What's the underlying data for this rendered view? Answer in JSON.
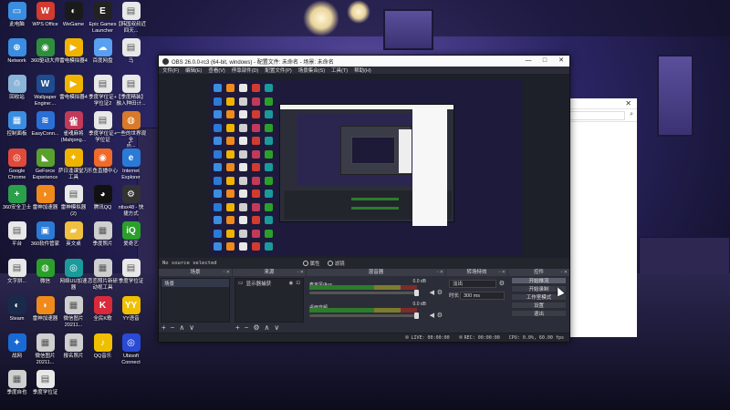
{
  "desktop": {
    "icons": [
      {
        "label": "此电脑",
        "icon": "computer-icon",
        "color": "#3a8de0",
        "glyph": "▭"
      },
      {
        "label": "WPS Office",
        "icon": "wps-icon",
        "color": "#d23b2f",
        "glyph": "W"
      },
      {
        "label": "WeGame",
        "icon": "wegame-icon",
        "color": "#1a1a1a",
        "glyph": "◐"
      },
      {
        "label": "Epic Games\nLauncher",
        "icon": "epic-games-icon",
        "color": "#222222",
        "glyph": "E"
      },
      {
        "label": "【韩国叔叔近\n四天...",
        "icon": "document-icon",
        "color": "#e8e8e8",
        "glyph": "▤"
      },
      {
        "label": "Network",
        "icon": "network-icon",
        "color": "#3a8de0",
        "glyph": "⊕"
      },
      {
        "label": "360驱动大师",
        "icon": "driver-master-icon",
        "color": "#2d8f3c",
        "glyph": "◉"
      },
      {
        "label": "雷电模拟器4",
        "icon": "ldplayer-icon",
        "color": "#f0b400",
        "glyph": "▶"
      },
      {
        "label": "百度网盘",
        "icon": "baidu-netdisk-icon",
        "color": "#5aa0f0",
        "glyph": "☁"
      },
      {
        "label": "马",
        "icon": "document-icon",
        "color": "#e8e8e8",
        "glyph": "▤"
      },
      {
        "label": "回收站",
        "icon": "recycle-bin-icon",
        "color": "#8ab4d8",
        "glyph": "♲"
      },
      {
        "label": "Wallpaper\nEngine:...",
        "icon": "wallpaper-engine-icon",
        "color": "#1f4b8f",
        "glyph": "W"
      },
      {
        "label": "雷电模拟器4",
        "icon": "ldplayer-icon",
        "color": "#f0b400",
        "glyph": "▶"
      },
      {
        "label": "季度学位证+\n学位证2",
        "icon": "document-icon",
        "color": "#e8e8e8",
        "glyph": "▤"
      },
      {
        "label": "【季度精装】\n融入种田计...",
        "icon": "document-icon",
        "color": "#e8e8e8",
        "glyph": "▤"
      },
      {
        "label": "控制面板",
        "icon": "control-panel-icon",
        "color": "#3a8de0",
        "glyph": "▦"
      },
      {
        "label": "EasyConn...",
        "icon": "easyconnect-icon",
        "color": "#2a6fd6",
        "glyph": "≋"
      },
      {
        "label": "雀魂麻将\n(Mahjong...",
        "icon": "mahjong-icon",
        "color": "#c23a5a",
        "glyph": "雀"
      },
      {
        "label": "季度学位证+\n学位证",
        "icon": "document-icon",
        "color": "#e8e8e8",
        "glyph": "▤"
      },
      {
        "label": "一些的世界观全\n点...",
        "icon": "world-icon",
        "color": "#d87a2a",
        "glyph": "◍"
      },
      {
        "label": "Google\nChrome",
        "icon": "chrome-icon",
        "color": "#e04a3a",
        "glyph": "◎"
      },
      {
        "label": "GeForce\nExperience",
        "icon": "geforce-icon",
        "color": "#5aa02c",
        "glyph": "◣"
      },
      {
        "label": "萨日逢课堂万\n工具",
        "icon": "app-icon",
        "color": "#f0b400",
        "glyph": "✦"
      },
      {
        "label": "乐鱼直播中心",
        "icon": "live-icon",
        "color": "#f06a2a",
        "glyph": "◉"
      },
      {
        "label": "Internet\nExplorer",
        "icon": "ie-icon",
        "color": "#2a7ad6",
        "glyph": "e"
      },
      {
        "label": "360安全卫士",
        "icon": "360-safe-icon",
        "color": "#2aa04a",
        "glyph": "+"
      },
      {
        "label": "雷神加速器",
        "icon": "leishen-icon",
        "color": "#f08a1a",
        "glyph": "◗"
      },
      {
        "label": "雷神模拟器\n(2)",
        "icon": "emulator-icon",
        "color": "#e8e8e8",
        "glyph": "▤"
      },
      {
        "label": "腾讯QQ",
        "icon": "qq-icon",
        "color": "#111111",
        "glyph": "◕"
      },
      {
        "label": "ntlsx48 - 快\n捷方式",
        "icon": "shortcut-icon",
        "color": "#333333",
        "glyph": "⚙"
      },
      {
        "label": "平台",
        "icon": "document-icon",
        "color": "#e8e8e8",
        "glyph": "▤"
      },
      {
        "label": "360软件管家",
        "icon": "360-software-icon",
        "color": "#2a7ad6",
        "glyph": "▣"
      },
      {
        "label": "英文桌",
        "icon": "folder-icon",
        "color": "#f0c040",
        "glyph": "▰"
      },
      {
        "label": "季度照片",
        "icon": "photo-icon",
        "color": "#cfcfcf",
        "glyph": "▦"
      },
      {
        "label": "爱奇艺",
        "icon": "iqiyi-icon",
        "color": "#2aa02a",
        "glyph": "iQ"
      },
      {
        "label": "文字拼...",
        "icon": "document-icon",
        "color": "#e8e8e8",
        "glyph": "▤"
      },
      {
        "label": "微信",
        "icon": "wechat-icon",
        "color": "#2aa02a",
        "glyph": "◍"
      },
      {
        "label": "网络UU加速\n器",
        "icon": "uu-booster-icon",
        "color": "#1a9a9a",
        "glyph": "◎"
      },
      {
        "label": "恋恋照片新研\n动视工具",
        "icon": "photo-icon",
        "color": "#cfcfcf",
        "glyph": "▦"
      },
      {
        "label": "季度学位证",
        "icon": "document-icon",
        "color": "#e8e8e8",
        "glyph": "▤"
      },
      {
        "label": "Steam",
        "icon": "steam-icon",
        "color": "#1a2a4a",
        "glyph": "◐"
      },
      {
        "label": "雷神加速器",
        "icon": "leishen-icon",
        "color": "#f08a1a",
        "glyph": "◗"
      },
      {
        "label": "微信图片\n20211...",
        "icon": "photo-icon",
        "color": "#cfcfcf",
        "glyph": "▦"
      },
      {
        "label": "全民K歌",
        "icon": "karaoke-icon",
        "color": "#d82a3a",
        "glyph": "K"
      },
      {
        "label": "YY语音",
        "icon": "yy-icon",
        "color": "#f0c000",
        "glyph": "YY"
      },
      {
        "label": "战网",
        "icon": "battlenet-icon",
        "color": "#1a6ad6",
        "glyph": "✦"
      },
      {
        "label": "微信图片\n20211...",
        "icon": "photo-icon",
        "color": "#cfcfcf",
        "glyph": "▦"
      },
      {
        "label": "报名照片",
        "icon": "photo-icon",
        "color": "#cfcfcf",
        "glyph": "▦"
      },
      {
        "label": "QQ音乐",
        "icon": "qq-music-icon",
        "color": "#f0c000",
        "glyph": "♪"
      },
      {
        "label": "Ubisoft\nConnect",
        "icon": "ubisoft-icon",
        "color": "#2a4ad6",
        "glyph": "◎"
      },
      {
        "label": "季度自也",
        "icon": "photo-icon",
        "color": "#cfcfcf",
        "glyph": "▦"
      },
      {
        "label": "季度学位证",
        "icon": "document-icon",
        "color": "#e8e8e8",
        "glyph": "▤"
      }
    ]
  },
  "obs": {
    "title": "OBS 26.0.0-rc3 (64-bit, windows) - 配置文件: 未命名 - 场景: 未命名",
    "menu": [
      "文件(F)",
      "编辑(E)",
      "查看(V)",
      "停靠部件(D)",
      "配置文件(P)",
      "场景集合(S)",
      "工具(T)",
      "帮助(H)"
    ],
    "preview_status": "No source selected",
    "props_label": "属性",
    "filters_label": "滤镜",
    "docks": {
      "scenes": {
        "title": "场景",
        "items": [
          "场景"
        ]
      },
      "sources": {
        "title": "来源",
        "items": [
          "显示器捕获"
        ]
      },
      "mixer": {
        "title": "混音器",
        "channels": [
          {
            "name": "麦克风/Aux",
            "db": "0.0 dB"
          },
          {
            "name": "桌面音频",
            "db": "0.0 dB"
          }
        ]
      },
      "transitions": {
        "title": "转场特效",
        "type": "淡出",
        "duration_label": "时长",
        "duration": "300 ms"
      },
      "controls": {
        "title": "控件",
        "buttons": [
          "开始推流",
          "开始录制",
          "工作室模式",
          "设置",
          "退出"
        ],
        "active_index": 0
      }
    },
    "statusbar": {
      "live": "LIVE: 00:00:00",
      "rec": "REC: 00:00:00",
      "cpu": "CPU: 0.0%, 60.00 fps"
    }
  }
}
